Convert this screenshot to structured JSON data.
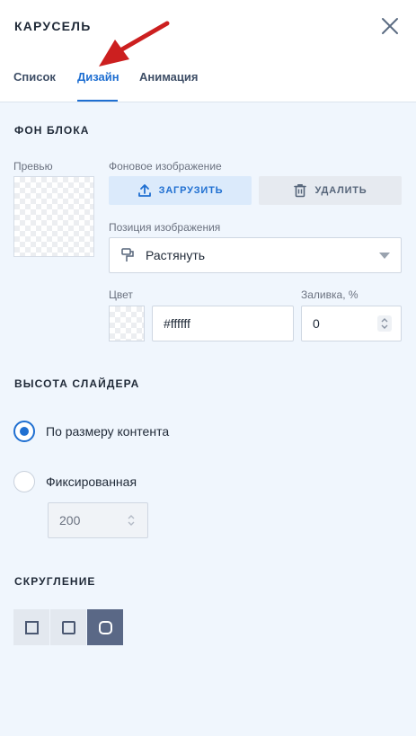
{
  "panel": {
    "title": "КАРУСЕЛЬ",
    "tabs": [
      {
        "label": "Список",
        "active": false
      },
      {
        "label": "Дизайн",
        "active": true
      },
      {
        "label": "Анимация",
        "active": false
      }
    ],
    "accent_color": "#1f6fd1"
  },
  "background": {
    "section_title": "ФОН БЛОКА",
    "preview_label": "Превью",
    "image_label": "Фоновое изображение",
    "upload_label": "ЗАГРУЗИТЬ",
    "delete_label": "УДАЛИТЬ",
    "position_label": "Позиция изображения",
    "position_value": "Растянуть",
    "color_label": "Цвет",
    "color_value": "#ffffff",
    "fill_label": "Заливка, %",
    "fill_value": "0"
  },
  "slider_height": {
    "section_title": "ВЫСОТА СЛАЙДЕРА",
    "options": [
      {
        "label": "По размеру контента",
        "checked": true
      },
      {
        "label": "Фиксированная",
        "checked": false
      }
    ],
    "fixed_value": "200"
  },
  "rounding": {
    "section_title": "СКРУГЛЕНИЕ",
    "options": [
      "none",
      "small",
      "large"
    ],
    "selected": "large"
  },
  "icons": {
    "close": "close-icon",
    "upload": "upload-icon",
    "delete": "trash-icon",
    "position": "paint-roller-icon",
    "caret": "chevron-down-icon",
    "annotation": "red-arrow-icon"
  }
}
